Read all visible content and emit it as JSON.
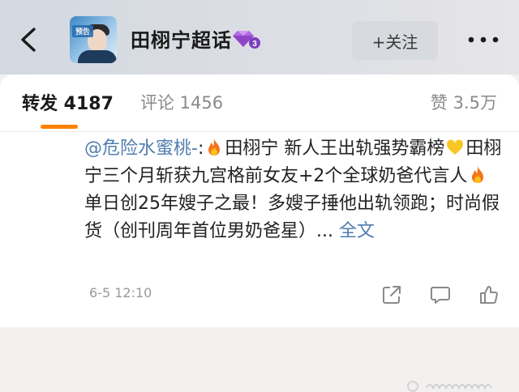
{
  "header": {
    "topic_title": "田栩宁超话",
    "follow_label": "+关注",
    "avatar_badge_text": "预告"
  },
  "tabs": {
    "repost": "转发 4187",
    "comment": "评论 1456",
    "like": "赞 3.5万"
  },
  "post": {
    "mention": "@危险水蜜桃-",
    "colon": ":",
    "seg1": "田栩宁 新人王出轨强势霸榜",
    "seg2": "田栩宁三个月斩获九宫格前女友+2个全球奶爸代言人",
    "seg3": "单日创25年嫂子之最！多嫂子捶他出轨领跑；时尚假货（创刊周年首位男奶爸星）... ",
    "full_text": "全文",
    "time": "6-5 12:10"
  },
  "colors": {
    "accent_orange": "#ff8200",
    "link_blue": "#507daf",
    "gem_purple": "#9b59d0"
  },
  "icons": [
    "back-chevron-icon",
    "gem-level-icon",
    "more-dots-icon",
    "fire-emoji-icon",
    "yellow-heart-emoji-icon",
    "share-icon",
    "comment-icon",
    "like-icon"
  ]
}
